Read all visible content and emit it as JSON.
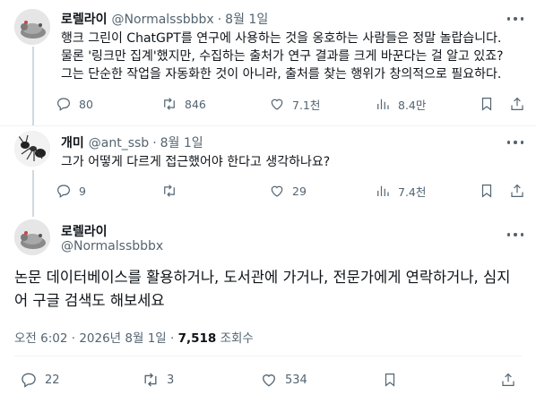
{
  "tweets": [
    {
      "author": "로렐라이",
      "handle": "@Normalssbbbx",
      "time": "8월 1일",
      "text": [
        "행크 그린이 ChatGPT를 연구에 사용하는 것을 옹호하는 사람들은 정말 놀랍습니다.",
        "물론 '링크만 집계'했지만, 수집하는 출처가 연구 결과를 크게 바꾼다는 걸 알고 있죠?",
        "그는 단순한 작업을 자동화한 것이 아니라, 출처를 찾는 행위가 창의적으로 필요하다."
      ],
      "replies": "80",
      "retweets": "846",
      "likes": "7.1천",
      "views": "8.4만"
    },
    {
      "author": "개미",
      "handle": "@ant_ssb",
      "time": "8월 1일",
      "text": [
        "그가 어떻게 다르게 접근했어야 한다고 생각하나요?"
      ],
      "replies": "9",
      "retweets": "",
      "likes": "29",
      "views": "7.4천"
    }
  ],
  "main": {
    "author": "로렐라이",
    "handle": "@Normalssbbbx",
    "text": [
      "논문 데이터베이스를 활용하거나, 도서관에 가거나, 전문가에게 연락하거나, 심지",
      "어 구글 검색도 해보세요"
    ],
    "timestamp": "오전 6:02 · 2026년 8월 1일 · ",
    "views_count": "7,518",
    "views_label": " 조회수",
    "replies": "22",
    "retweets": "3",
    "likes": "534"
  },
  "separator": "·",
  "icons": [
    "more-icon",
    "reply-icon",
    "retweet-icon",
    "like-icon",
    "views-icon",
    "bookmark-icon",
    "share-icon"
  ]
}
